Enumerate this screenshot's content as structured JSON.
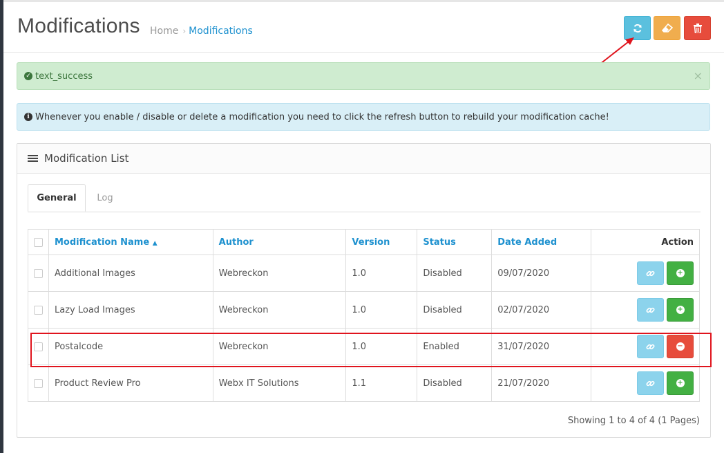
{
  "header": {
    "title": "Modifications",
    "breadcrumb": [
      {
        "label": "Home"
      },
      {
        "label": "Modifications"
      }
    ],
    "buttons": {
      "refresh_icon": "refresh-icon",
      "clear_icon": "eraser-icon",
      "delete_icon": "trash-icon"
    }
  },
  "alerts": {
    "success_text": "text_success",
    "close_label": "×",
    "info_text": "Whenever you enable / disable or delete a modification you need to click the refresh button to rebuild your modification cache!"
  },
  "panel": {
    "title": "Modification List",
    "tabs": [
      {
        "label": "General",
        "active": true
      },
      {
        "label": "Log",
        "active": false
      }
    ]
  },
  "table": {
    "headers": {
      "name": "Modification Name",
      "author": "Author",
      "version": "Version",
      "status": "Status",
      "date": "Date Added",
      "action": "Action"
    },
    "rows": [
      {
        "name": "Additional Images",
        "author": "Webreckon",
        "version": "1.0",
        "status": "Disabled",
        "date": "09/07/2020",
        "toggle": "enable"
      },
      {
        "name": "Lazy Load Images",
        "author": "Webreckon",
        "version": "1.0",
        "status": "Disabled",
        "date": "02/07/2020",
        "toggle": "enable"
      },
      {
        "name": "Postalcode",
        "author": "Webreckon",
        "version": "1.0",
        "status": "Enabled",
        "date": "31/07/2020",
        "toggle": "disable"
      },
      {
        "name": "Product Review Pro",
        "author": "Webx IT Solutions",
        "version": "1.1",
        "status": "Disabled",
        "date": "21/07/2020",
        "toggle": "enable"
      }
    ]
  },
  "pagination": {
    "text": "Showing 1 to 4 of 4 (1 Pages)"
  },
  "colors": {
    "accent": "#1e91cf",
    "annotation": "#e0141d",
    "refresh_button": "#5bc0de",
    "clear_button": "#f0ad4e",
    "delete_button": "#e74c3c"
  }
}
